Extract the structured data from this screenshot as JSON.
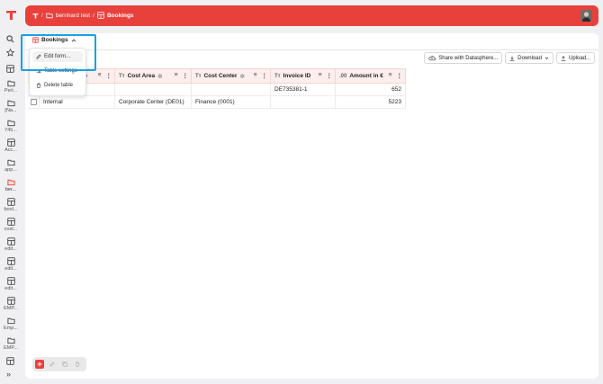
{
  "breadcrumb": {
    "sep": "/",
    "folder": "bernhard test",
    "current": "Bookings"
  },
  "sidebar": {
    "items": [
      {
        "label": "Peri..."
      },
      {
        "label": "[Na..."
      },
      {
        "label": "745..."
      },
      {
        "label": "Acc..."
      },
      {
        "label": "app..."
      },
      {
        "label": "ber..."
      },
      {
        "label": "bool..."
      },
      {
        "label": "cost..."
      },
      {
        "label": "edit..."
      },
      {
        "label": "edit..."
      },
      {
        "label": "edit..."
      },
      {
        "label": "EMP..."
      },
      {
        "label": "Emp..."
      },
      {
        "label": "EMP..."
      }
    ],
    "expand": "»"
  },
  "tab": {
    "label": "Bookings"
  },
  "toolbar": {
    "share": "Share with Datasphere...",
    "download": "Download",
    "upload": "Upload..."
  },
  "table": {
    "headers": [
      {
        "type": "",
        "label": "e"
      },
      {
        "type": "Tт",
        "label": "Cost Area"
      },
      {
        "type": "Tт",
        "label": "Cost Center"
      },
      {
        "type": "Tт",
        "label": "Invoice ID"
      },
      {
        "type": ".00",
        "label": "Amount in €"
      }
    ],
    "rows": [
      {
        "type": "",
        "cost_area": "",
        "cost_center": "",
        "invoice": "DE735381-1",
        "amount": "652"
      },
      {
        "type": "Internal",
        "cost_area": "Corporate Center (DE01)",
        "cost_center": "Finance (0001)",
        "invoice": "",
        "amount": "5223"
      }
    ]
  },
  "menu": {
    "edit": "Edit form...",
    "settings": "Table settings",
    "delete": "Delete table"
  },
  "colors": {
    "brand": "#e8413c",
    "highlight": "#19a0e6",
    "header_bg": "#fbeeed"
  }
}
